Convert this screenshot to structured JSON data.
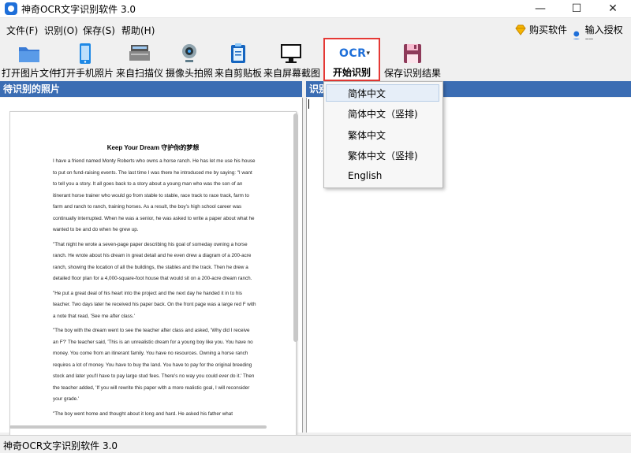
{
  "window": {
    "title": "神奇OCR文字识别软件 3.0",
    "minimize": "—",
    "maximize": "☐",
    "close": "✕"
  },
  "menu": {
    "items": [
      "文件(F)",
      "识别(O)",
      "保存(S)",
      "帮助(H)"
    ],
    "buy": "购买软件",
    "license": "输入授权码"
  },
  "toolbar": {
    "open_image": "打开图片文件",
    "open_phone": "打开手机照片",
    "scanner": "来自扫描仪",
    "camera": "摄像头拍照",
    "clipboard": "来自剪贴板",
    "screenshot": "来自屏幕截图",
    "ocr_logo": "OCR",
    "start": "开始识别",
    "save": "保存识别结果"
  },
  "left_panel": {
    "header": "待识别的照片",
    "document": {
      "title": "Keep Your Dream 守护你的梦想",
      "paragraphs": [
        "I have a friend named Monty Roberts who owns a horse ranch. He has let me use his house to put on fund-raising events. The last time I was there he introduced me by saying: \"I want to tell you a story. It all goes back to a story about a young man who was the son of an itinerant horse trainer who would go from stable to stable, race track to race track, farm to farm and ranch to ranch, training horses. As a result, the boy's high school career was continually interrupted. When he was a senior, he was asked to write a paper about what he wanted to be and do when he grew up.",
        "\"That night he wrote a seven-page paper describing his goal of someday owning a horse ranch. He wrote about his dream in great detail and he even drew a diagram of a 200-acre ranch, showing the location of all the buildings, the stables and the track. Then he drew a detailed floor plan for a 4,000-square-foot house that would sit on a 200-acre dream ranch.",
        "\"He put a great deal of his heart into the project and the next day he handed it in to his teacher. Two days later he received his paper back. On the front page was a large red F with a note that read, 'See me after class.'",
        "\"The boy with the dream went to see the teacher after class and asked, 'Why did I receive an F?' The teacher said, 'This is an unrealistic dream for a young boy like you. You have no money. You come from an itinerant family. You have no resources. Owning a horse ranch requires a lot of money. You have to buy the land. You have to pay for the original breeding stock and later you'll have to pay large stud fees. There's no way you could ever do it.' Then the teacher added, 'If you will rewrite this paper with a more realistic goal, I will reconsider your grade.'",
        "\"The boy went home and thought about it long and hard. He asked his father what"
      ]
    }
  },
  "right_panel": {
    "header": "识别"
  },
  "ocr_menu": {
    "options": [
      "简体中文",
      "简体中文（竖排)",
      "繁体中文",
      "繁体中文（竖排)",
      "English"
    ],
    "selected_index": 0
  },
  "status": {
    "text": "神奇OCR文字识别软件 3.0"
  },
  "colors": {
    "header_blue": "#3b6db3",
    "highlight_red": "#e53935",
    "ocr_blue": "#1e6fd9"
  }
}
